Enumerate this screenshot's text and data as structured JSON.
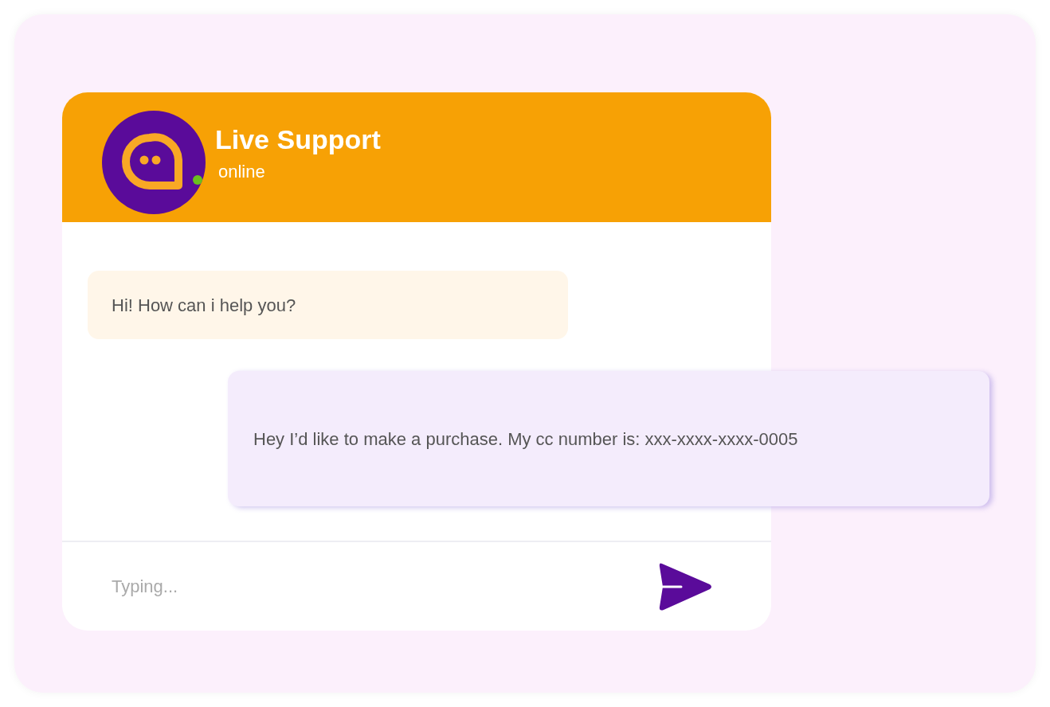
{
  "header": {
    "title": "Live Support",
    "status": "online"
  },
  "messages": [
    {
      "kind": "incoming",
      "text": "Hi! How can i help you?"
    },
    {
      "kind": "outgoing",
      "text": "Hey I’d like to make a purchase. My cc number is: xxx-xxxx-xxxx-0005"
    }
  ],
  "composer": {
    "placeholder": "Typing..."
  }
}
